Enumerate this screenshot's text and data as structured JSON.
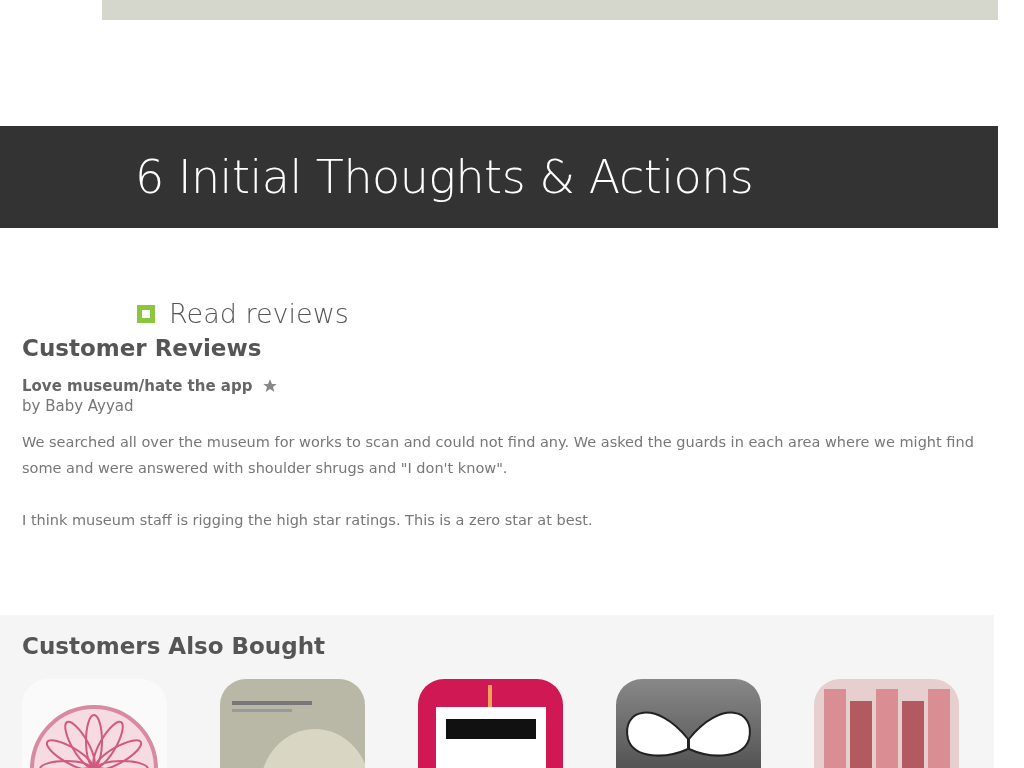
{
  "slide": {
    "title": "6 Initial Thoughts & Actions",
    "bullets": [
      "Read reviews"
    ]
  },
  "reviews": {
    "heading": "Customer Reviews",
    "items": [
      {
        "title": "Love museum/hate the app",
        "author": "by Baby Ayyad",
        "paragraphs": [
          "We searched all over the museum for works to scan and could not find any. We asked the guards in each area where we might find some and were answered with shoulder shrugs and \"I don't know\".",
          "I think museum staff is rigging the high star ratings. This is a zero star at best."
        ]
      }
    ]
  },
  "also_bought": {
    "heading": "Customers Also Bought",
    "apps": [
      {
        "kind": "flower"
      },
      {
        "kind": "ceramics"
      },
      {
        "kind": "art"
      },
      {
        "kind": "butterfly"
      },
      {
        "kind": "buildings"
      }
    ]
  }
}
